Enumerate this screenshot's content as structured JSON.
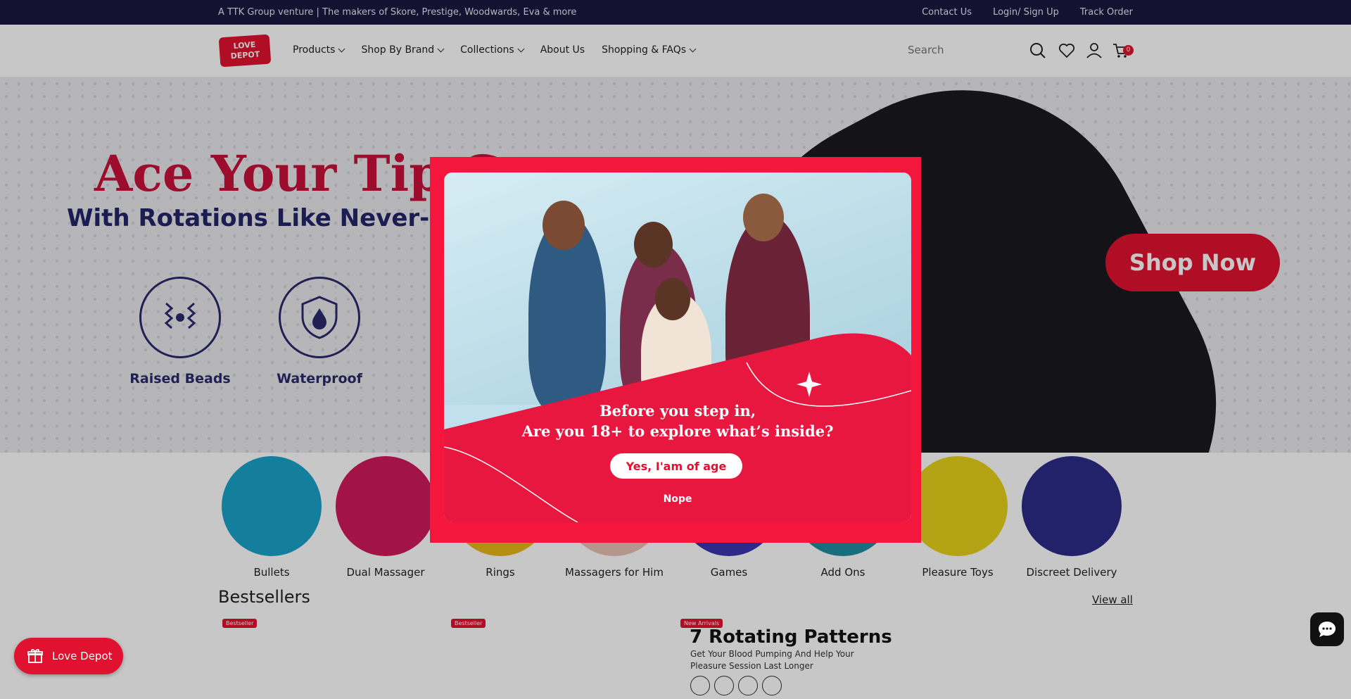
{
  "topbar": {
    "tagline": "A TTK Group venture | The makers of Skore, Prestige, Woodwards, Eva & more",
    "links": [
      "Contact Us",
      "Login/ Sign Up",
      "Track Order"
    ]
  },
  "header": {
    "logo_line1": "LOVE",
    "logo_line2": "DEPOT",
    "nav": [
      {
        "label": "Products",
        "has_dropdown": true
      },
      {
        "label": "Shop By Brand",
        "has_dropdown": true
      },
      {
        "label": "Collections",
        "has_dropdown": true
      },
      {
        "label": "About Us",
        "has_dropdown": false
      },
      {
        "label": "Shopping & FAQs",
        "has_dropdown": true
      }
    ],
    "search_placeholder": "Search",
    "cart_count": "0",
    "icons": [
      "search-icon",
      "heart-icon",
      "user-icon",
      "cart-icon"
    ]
  },
  "hero": {
    "title": "Ace Your Tip G",
    "subtitle": "With Rotations Like Never-Befo",
    "features": [
      "Raised Beads",
      "Waterproof"
    ],
    "cta": "Shop Now",
    "colors": {
      "title": "#c8103a",
      "subtitle": "#23246a",
      "cta": "#e0122f"
    }
  },
  "categories": [
    {
      "label": "Bullets",
      "color": "#1aa3c8"
    },
    {
      "label": "Dual Massager",
      "color": "#d01a5a"
    },
    {
      "label": "Rings",
      "color": "#e8b61a"
    },
    {
      "label": "Massagers for Him",
      "color": "#e7c1b5"
    },
    {
      "label": "Games",
      "color": "#3a35b0"
    },
    {
      "label": "Add Ons",
      "color": "#1f8ea0"
    },
    {
      "label": "Pleasure Toys",
      "color": "#e7d21c"
    },
    {
      "label": "Discreet Delivery",
      "color": "#2c2c8a"
    }
  ],
  "bestsellers": {
    "title": "Bestsellers",
    "view_all": "View all",
    "badges": [
      "Bestseller",
      "Bestseller",
      "New Arrivals"
    ],
    "promo_title": "7 Rotating Patterns",
    "promo_subtitle": "Get Your Blood Pumping And Help Your Pleasure Session Last Longer"
  },
  "modal": {
    "question_line1": "Before you step in,",
    "question_line2": "Are you 18+ to explore what’s inside?",
    "yes_label": "Yes, I'am of age",
    "no_label": "Nope",
    "colors": {
      "frame": "#f5163d",
      "accent": "#e0122f"
    }
  },
  "floating": {
    "rewards_label": "Love Depot",
    "icons": [
      "gift-icon",
      "chat-icon"
    ]
  }
}
